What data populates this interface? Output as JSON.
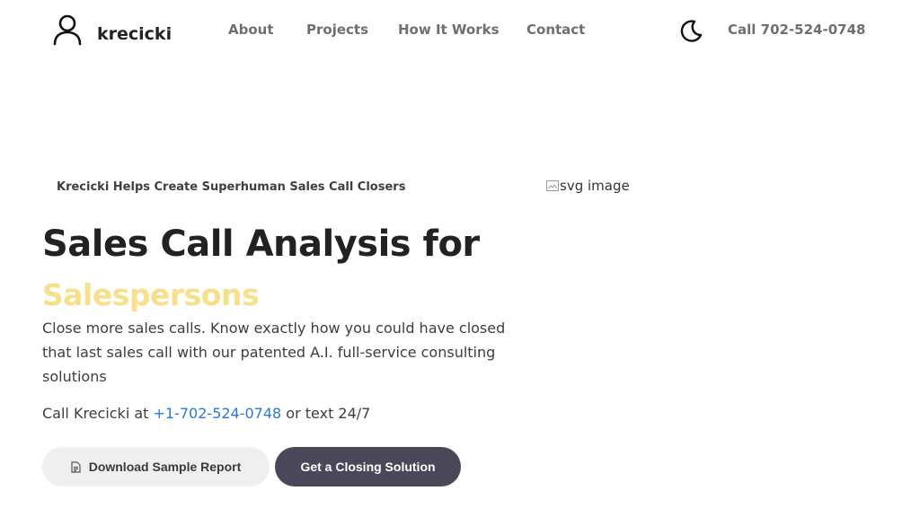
{
  "header": {
    "brand": "krecicki",
    "nav": [
      "About",
      "Projects",
      "How It Works",
      "Contact"
    ],
    "call_label": "Call 702-524-0748"
  },
  "hero": {
    "eyebrow": "Krecicki Helps Create Superhuman Sales Call Closers",
    "headline": "Sales Call Analysis for",
    "highlight": "Salespersons",
    "lead": "Close more sales calls. Know exactly how you could have closed that last sales call with our patented A.I. full-service consulting solutions",
    "contact_prefix": "Call Krecicki at ",
    "contact_phone": "+1-702-524-0748",
    "contact_suffix": " or text 24/7",
    "image_alt": "svg image"
  },
  "buttons": {
    "download": "Download Sample Report",
    "closing": "Get a Closing Solution"
  },
  "colors": {
    "highlight": "#f7e08c",
    "link": "#2a78d4",
    "primary_button": "#4a4858",
    "secondary_button": "#efefef"
  },
  "icons": {
    "brand": "user-icon",
    "theme_toggle": "moon-icon",
    "download": "document-icon",
    "image": "broken-image-icon"
  }
}
